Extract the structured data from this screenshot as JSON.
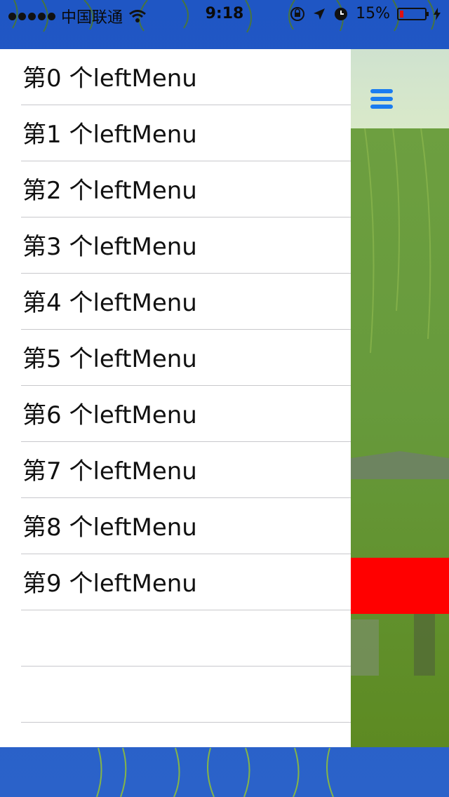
{
  "status_bar": {
    "carrier": "中国联通",
    "time": "9:18",
    "battery_percent": "15%",
    "battery_level": 0.15,
    "signal_bars": 5
  },
  "drawer": {
    "items": [
      {
        "label": "第0 个leftMenu"
      },
      {
        "label": "第1 个leftMenu"
      },
      {
        "label": "第2 个leftMenu"
      },
      {
        "label": "第3 个leftMenu"
      },
      {
        "label": "第4 个leftMenu"
      },
      {
        "label": "第5 个leftMenu"
      },
      {
        "label": "第6 个leftMenu"
      },
      {
        "label": "第7 个leftMenu"
      },
      {
        "label": "第8 个leftMenu"
      },
      {
        "label": "第9 个leftMenu"
      },
      {
        "label": ""
      },
      {
        "label": ""
      }
    ]
  },
  "main": {
    "menu_icon": "hamburger-icon",
    "accent_color": "#1a7cf0",
    "banner_color": "#ff0000"
  }
}
